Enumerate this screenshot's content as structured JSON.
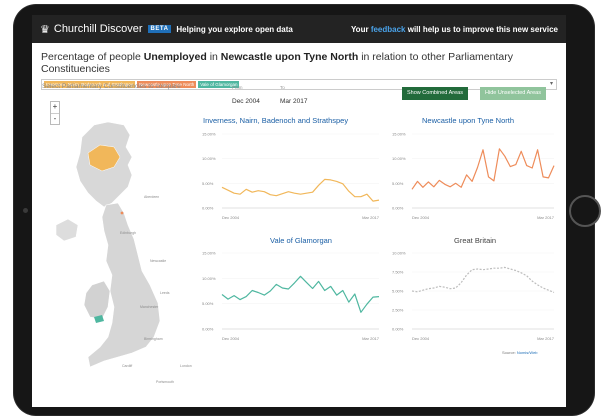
{
  "topbar": {
    "brand": "Churchill Discover",
    "badge": "BETA",
    "tagline": "Helping you explore open data",
    "feedback_prefix": "Your",
    "feedback_link": "feedback",
    "feedback_suffix": "will help us to improve this new service"
  },
  "headline": {
    "prefix": "Percentage of people",
    "measure": "Unemployed",
    "mid": "in",
    "place": "Newcastle upon Tyne North",
    "suffix": "in relation to other Parliamentary Constituencies"
  },
  "chips": [
    "Inverness, Nairn, Badenoch and Strathspey",
    "Newcastle upon Tyne North",
    "Vale of Glamorgan"
  ],
  "map": {
    "hint": "Select Parliamentary Constituencies to compare",
    "zoom_in": "+",
    "zoom_out": "-",
    "towns": [
      "Aberdeen",
      "Edinburgh",
      "Newcastle",
      "Leeds",
      "Manchester",
      "Birmingham",
      "London",
      "Cardiff",
      "Portsmouth"
    ]
  },
  "range": {
    "from_label": "From",
    "from_value": "Dec 2004",
    "to_label": "To",
    "to_value": "Mar 2017"
  },
  "buttons": {
    "show_combined": "Show Combined Areas",
    "hide_unselected": "Hide Unselected Areas"
  },
  "source": {
    "prefix": "Source:",
    "link": "Nomis/Web"
  },
  "colors": {
    "inverness": "#f1b75a",
    "newcastle": "#ee8c5a",
    "vale": "#4fb7a0",
    "gb": "#bdbdbd"
  },
  "chart_data": [
    {
      "type": "line",
      "title": "Inverness, Nairn, Badenoch and Strathspey",
      "yticks": [
        "15.00%",
        "10.00%",
        "5.00%",
        "0.00%"
      ],
      "ylim": [
        0,
        15
      ],
      "xlabels": [
        "Dec 2004",
        "Mar 2017"
      ],
      "series": [
        {
          "values": [
            4.2,
            3.6,
            3.0,
            2.8,
            3.8,
            3.2,
            3.5,
            3.3,
            2.7,
            2.5,
            2.9,
            3.3,
            3.0,
            2.8,
            3.0,
            3.2,
            4.6,
            5.8,
            5.7,
            5.4,
            4.9,
            3.4,
            2.3,
            2.3,
            2.8,
            1.4,
            1.6
          ]
        }
      ]
    },
    {
      "type": "line",
      "title": "Newcastle upon Tyne North",
      "yticks": [
        "15.00%",
        "10.00%",
        "5.00%",
        "0.00%"
      ],
      "ylim": [
        0,
        15
      ],
      "xlabels": [
        "Dec 2004",
        "Mar 2017"
      ],
      "series": [
        {
          "values": [
            3.8,
            5.4,
            4.2,
            5.3,
            4.3,
            5.6,
            4.8,
            4.3,
            5.0,
            4.2,
            6.7,
            5.4,
            8.2,
            11.8,
            6.3,
            5.5,
            12.0,
            10.5,
            8.4,
            8.8,
            11.5,
            8.6,
            8.1,
            11.8,
            6.3,
            6.1,
            8.6
          ]
        }
      ]
    },
    {
      "type": "line",
      "title": "Vale of Glamorgan",
      "yticks": [
        "15.00%",
        "10.00%",
        "5.00%",
        "0.00%"
      ],
      "ylim": [
        0,
        15
      ],
      "xlabels": [
        "Dec 2004",
        "Mar 2017"
      ],
      "series": [
        {
          "values": [
            6.8,
            5.9,
            6.6,
            5.8,
            6.4,
            7.6,
            7.2,
            6.7,
            7.5,
            8.8,
            8.1,
            7.9,
            9.1,
            10.4,
            9.2,
            8.0,
            9.4,
            7.6,
            8.4,
            6.7,
            7.6,
            5.3,
            6.9,
            3.3,
            4.9,
            6.3,
            6.4
          ]
        }
      ]
    },
    {
      "type": "line",
      "title": "Great Britain",
      "yticks": [
        "10.00%",
        "7.50%",
        "5.00%",
        "2.50%",
        "0.00%"
      ],
      "ylim": [
        0,
        10
      ],
      "xlabels": [
        "Dec 2004",
        "Mar 2017"
      ],
      "series": [
        {
          "values": [
            5.0,
            4.9,
            5.1,
            5.3,
            5.4,
            5.6,
            5.5,
            5.3,
            5.4,
            6.1,
            7.1,
            7.8,
            7.9,
            7.8,
            7.9,
            8.0,
            8.0,
            8.1,
            7.9,
            7.7,
            7.4,
            7.0,
            6.3,
            5.8,
            5.4,
            5.1,
            4.8
          ]
        }
      ]
    }
  ]
}
